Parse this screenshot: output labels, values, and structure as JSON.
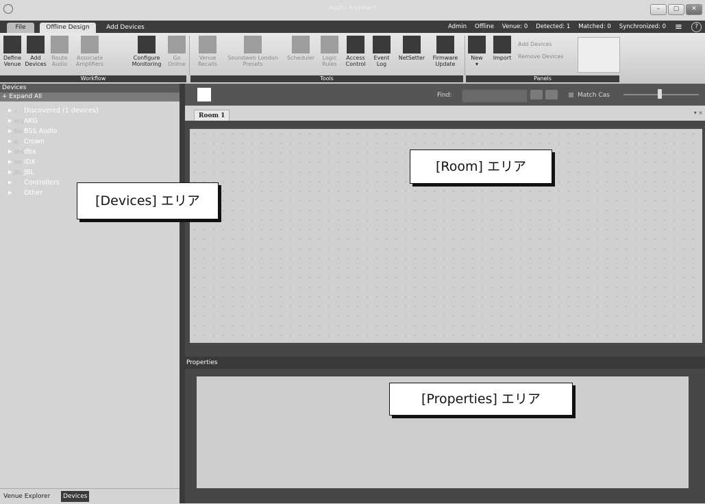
{
  "window": {
    "title": "Audio Architect",
    "controls": [
      "–",
      "▢",
      "✕"
    ]
  },
  "top_tabs": {
    "file": "File",
    "offline_design": "Offline Design",
    "add_devices": "Add Devices"
  },
  "status_bar": {
    "admin": "Admin",
    "offline": "Offline",
    "venue": "Venue: 0",
    "detected": "Detected: 1",
    "matched": "Matched: 0",
    "synchronized": "Synchronized: 0",
    "menu_icon": "≡",
    "help_icon": "?"
  },
  "ribbon": {
    "workflow": {
      "label": "Workflow",
      "buttons": [
        {
          "name": "define-venue",
          "line1": "Define",
          "line2": "Venue",
          "icon": "layout-icon"
        },
        {
          "name": "add-devices",
          "line1": "Add",
          "line2": "Devices",
          "icon": "list-plus-icon"
        },
        {
          "name": "route-audio",
          "line1": "Route",
          "line2": "Audio",
          "icon": "route-icon"
        },
        {
          "name": "associate-amplifiers",
          "line1": "Associate",
          "line2": "Amplifiers",
          "icon": "amplifier-icon"
        },
        {
          "name": "configure-monitoring",
          "line1": "Configure",
          "line2": "Monitoring",
          "icon": "monitor-gear-icon"
        },
        {
          "name": "go-online",
          "line1": "Go",
          "line2": "Online",
          "icon": "online-icon"
        }
      ]
    },
    "tools": {
      "label": "Tools",
      "buttons": [
        {
          "name": "venue-recalls",
          "line1": "Venue",
          "line2": "Recalls",
          "icon": "recall-icon"
        },
        {
          "name": "soundweb-london-presets",
          "line1": "Soundweb London",
          "line2": "Presets",
          "icon": "presets-icon"
        },
        {
          "name": "scheduler",
          "line1": "Scheduler",
          "line2": "",
          "icon": "clock-icon"
        },
        {
          "name": "logic-rules",
          "line1": "Logic",
          "line2": "Rules",
          "icon": "logic-icon"
        },
        {
          "name": "access-control",
          "line1": "Access",
          "line2": "Control",
          "icon": "key-icon"
        },
        {
          "name": "event-log",
          "line1": "Event",
          "line2": "Log",
          "icon": "list-icon"
        },
        {
          "name": "netsetter",
          "line1": "NetSetter",
          "line2": "",
          "icon": "arch-icon"
        },
        {
          "name": "firmware-update",
          "line1": "Firmware",
          "line2": "Update",
          "icon": "binary-icon"
        }
      ]
    },
    "panels": {
      "label": "Panels",
      "new_label": "New",
      "new_arrow": "▾",
      "import_label": "Import",
      "add_devices": "Add Devices",
      "remove_devices": "Remove Devices"
    }
  },
  "devices_panel": {
    "header": "Devices",
    "expand_all": "+ Expand All",
    "items": [
      {
        "label": "Discovered (1 devices)",
        "icon": "network-icon",
        "glyph": "⊥"
      },
      {
        "label": "AKG",
        "icon": "akg-logo-icon",
        "glyph": "akg"
      },
      {
        "label": "BSS Audio",
        "icon": "bss-logo-icon",
        "glyph": "Bss"
      },
      {
        "label": "Crown",
        "icon": "crown-logo-icon",
        "glyph": "◎"
      },
      {
        "label": "dbx",
        "icon": "dbx-logo-icon",
        "glyph": "dbx"
      },
      {
        "label": "IDX",
        "icon": "idx-logo-icon",
        "glyph": "idx"
      },
      {
        "label": "JBL",
        "icon": "jbl-logo-icon",
        "glyph": "JBL"
      },
      {
        "label": "Controllers",
        "icon": "",
        "glyph": ""
      },
      {
        "label": "Other",
        "icon": "",
        "glyph": ""
      }
    ],
    "bottom_tabs": {
      "venue_explorer": "Venue Explorer",
      "devices": "Devices"
    }
  },
  "room_toolbar": {
    "find_label": "Find:",
    "find_value": "",
    "match_case_label": "Match Cas"
  },
  "room_tab": {
    "label": "Room 1",
    "menu": "▾ ×"
  },
  "properties": {
    "header": "Properties"
  },
  "callouts": {
    "room": "[Room] エリア",
    "devices": "[Devices] エリア",
    "properties": "[Properties] エリア"
  }
}
